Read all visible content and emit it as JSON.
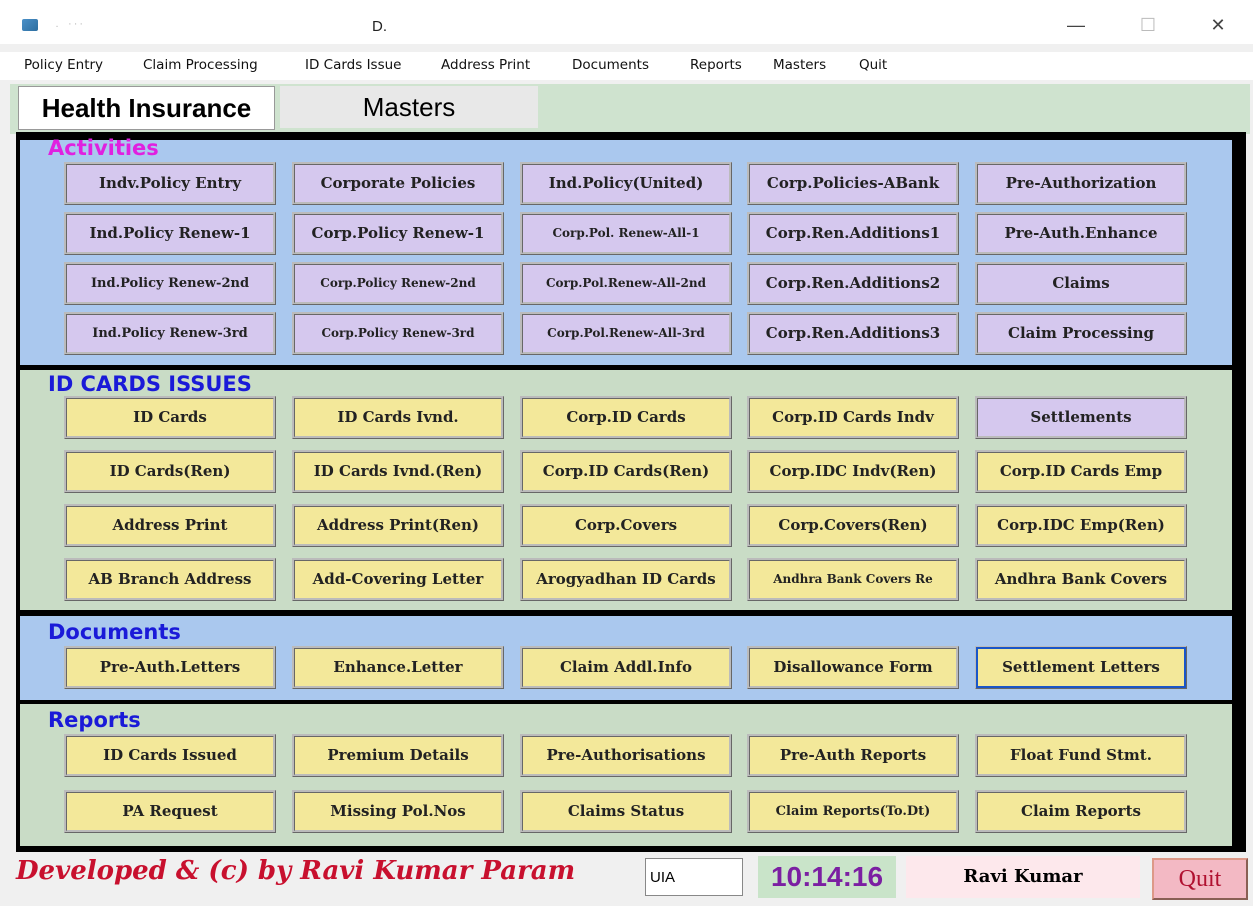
{
  "window": {
    "title": " . ···",
    "document_title": "D.",
    "minimize_icon": "minimize-icon",
    "maximize_icon": "maximize-icon",
    "close_icon": "close-icon"
  },
  "menu": [
    "Policy Entry",
    "Claim Processing",
    "ID Cards Issue",
    "Address Print",
    "Documents",
    "Reports",
    "Masters",
    "Quit"
  ],
  "tabs": [
    "Health Insurance",
    "Masters"
  ],
  "sections": {
    "activities": {
      "title": "Activities",
      "title_color": "#e020e0",
      "rows": [
        [
          "Indv.Policy Entry",
          "Corporate Policies",
          "Ind.Policy(United)",
          "Corp.Policies-ABank",
          "Pre-Authorization"
        ],
        [
          "Ind.Policy Renew-1",
          "Corp.Policy Renew-1",
          "Corp.Pol. Renew-All-1",
          "Corp.Ren.Additions1",
          "Pre-Auth.Enhance"
        ],
        [
          "Ind.Policy Renew-2nd",
          "Corp.Policy Renew-2nd",
          "Corp.Pol.Renew-All-2nd",
          "Corp.Ren.Additions2",
          "Claims"
        ],
        [
          "Ind.Policy Renew-3rd",
          "Corp.Policy Renew-3rd",
          "Corp.Pol.Renew-All-3rd",
          "Corp.Ren.Additions3",
          "Claim Processing"
        ]
      ]
    },
    "id_cards": {
      "title": "ID CARDS ISSUES",
      "title_color": "#1a1ad8",
      "rows": [
        [
          "ID Cards",
          "ID Cards Ivnd.",
          "Corp.ID Cards",
          "Corp.ID Cards Indv",
          "Settlements"
        ],
        [
          "ID Cards(Ren)",
          "ID Cards Ivnd.(Ren)",
          "Corp.ID Cards(Ren)",
          "Corp.IDC Indv(Ren)",
          "Corp.ID Cards Emp"
        ],
        [
          "Address Print",
          "Address Print(Ren)",
          "Corp.Covers",
          "Corp.Covers(Ren)",
          "Corp.IDC Emp(Ren)"
        ],
        [
          "AB Branch Address",
          "Add-Covering Letter",
          "Arogyadhan ID Cards",
          "Andhra Bank Covers Re",
          "Andhra Bank Covers"
        ]
      ]
    },
    "documents": {
      "title": "Documents",
      "title_color": "#1a1ad8",
      "rows": [
        [
          "Pre-Auth.Letters",
          "Enhance.Letter",
          "Claim Addl.Info",
          "Disallowance Form",
          "Settlement Letters"
        ]
      ]
    },
    "reports": {
      "title": "Reports",
      "title_color": "#1a1ad8",
      "rows": [
        [
          "ID Cards Issued",
          "Premium Details",
          "Pre-Authorisations",
          "Pre-Auth Reports",
          "Float Fund Stmt."
        ],
        [
          "PA Request",
          "Missing Pol.Nos",
          "Claims Status",
          "Claim Reports(To.Dt)",
          "Claim Reports"
        ]
      ]
    }
  },
  "footer": {
    "developer": "Developed & (c) by Ravi Kumar Param",
    "code_value": "UIA",
    "clock": "10:14:16",
    "user": "Ravi Kumar",
    "quit": "Quit"
  }
}
